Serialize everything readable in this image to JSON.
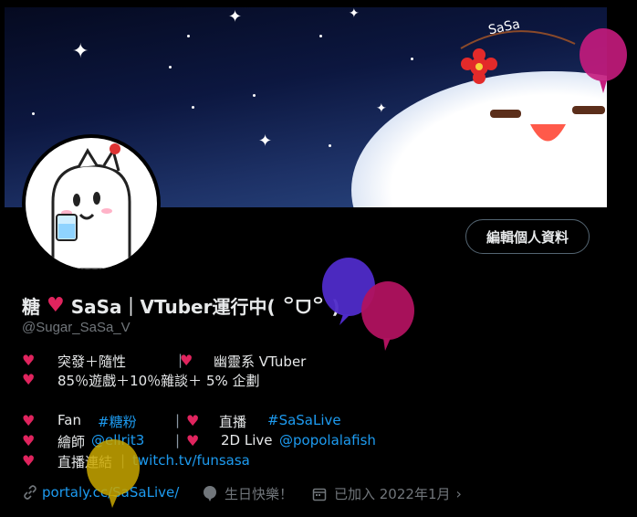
{
  "profile": {
    "edit_button": "編輯個人資料",
    "name_prefix": "糖",
    "name_suffix": "SaSa｜VTuber運行中( ꒪ᗜ꒪ )",
    "handle": "@Sugar_SaSa_V"
  },
  "bio": {
    "line1_a": "突發＋隨性",
    "line1_b": "幽靈系 VTuber",
    "line2": "85％遊戲＋10％雜談＋ 5% 企劃",
    "fan_label": "Fan",
    "fan_tag": "#糖粉",
    "live_label": "直播",
    "live_tag": "#SaSaLive",
    "artist_label": "繪師",
    "artist_handle": "@ellrit3",
    "live2d_label": "2D Live",
    "live2d_handle": "@popolalafish",
    "stream_label": "直播連結",
    "stream_url": "twitch.tv/funsasa"
  },
  "meta": {
    "website": "portaly.cc/SaSaLive/",
    "birthday": "生日快樂！",
    "joined": "已加入 2022年1月"
  },
  "banner": {
    "caption": "SaSa"
  },
  "icons": [
    "heart-icon",
    "link-icon",
    "balloon-location-icon",
    "calendar-icon",
    "chevron-right-icon"
  ],
  "colors": {
    "accent": "#1d9bf0",
    "heart": "#e0245e",
    "muted": "#71767b",
    "text": "#e7e9ea"
  }
}
